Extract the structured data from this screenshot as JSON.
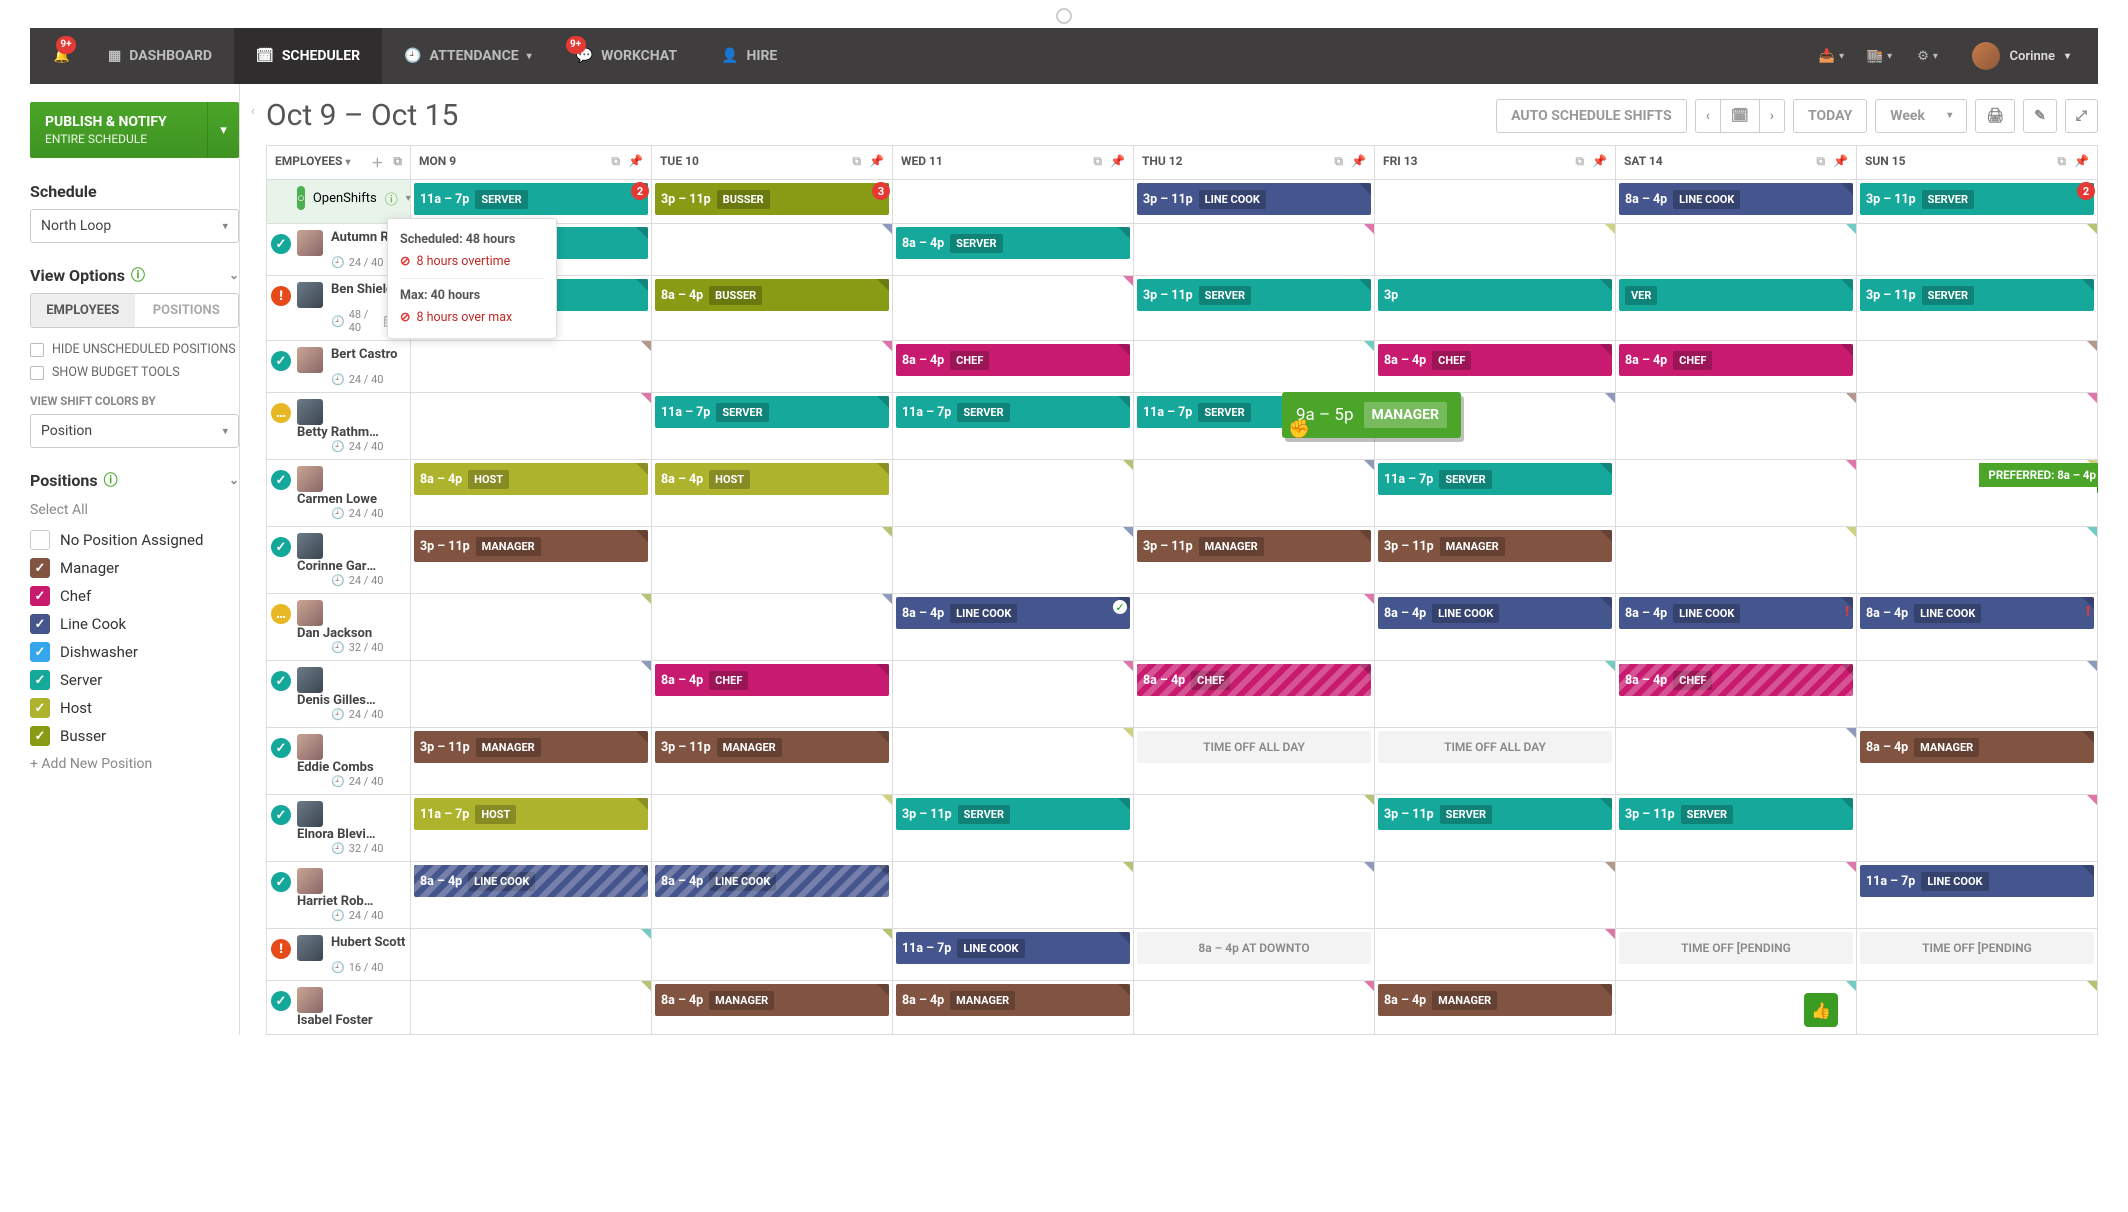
{
  "nav": {
    "alerts_badge": "9+",
    "dashboard": "DASHBOARD",
    "scheduler": "SCHEDULER",
    "attendance": "ATTENDANCE",
    "workchat": "WORKCHAT",
    "workchat_badge": "9+",
    "hire": "HIRE",
    "user": "Corinne"
  },
  "sidebar": {
    "publish_title": "PUBLISH & NOTIFY",
    "publish_sub": "ENTIRE SCHEDULE",
    "schedule_h": "Schedule",
    "schedule_value": "North Loop",
    "viewopts_h": "View Options",
    "toggle_emp": "EMPLOYEES",
    "toggle_pos": "POSITIONS",
    "chk_hide": "HIDE UNSCHEDULED POSITIONS",
    "chk_budget": "SHOW BUDGET TOOLS",
    "colors_label": "VIEW SHIFT COLORS BY",
    "colors_value": "Position",
    "positions_h": "Positions",
    "select_all": "Select All",
    "add_pos": "+ Add New Position",
    "positions": [
      {
        "label": "No Position Assigned",
        "color": "#fff",
        "empty": true
      },
      {
        "label": "Manager",
        "color": "#805441"
      },
      {
        "label": "Chef",
        "color": "#c81b70"
      },
      {
        "label": "Line Cook",
        "color": "#45558e"
      },
      {
        "label": "Dishwasher",
        "color": "#36a6ec"
      },
      {
        "label": "Server",
        "color": "#15a89b"
      },
      {
        "label": "Host",
        "color": "#aeb32e"
      },
      {
        "label": "Busser",
        "color": "#879b14"
      }
    ]
  },
  "toolbar": {
    "date_range": "Oct 9 – Oct 15",
    "auto": "AUTO SCHEDULE SHIFTS",
    "today": "TODAY",
    "view": "Week"
  },
  "days": [
    "EMPLOYEES",
    "MON 9",
    "TUE 10",
    "WED 11",
    "THU 12",
    "FRI 13",
    "SAT 14",
    "SUN 15"
  ],
  "open": {
    "label": "OpenShifts"
  },
  "openshifts": [
    {
      "day": 1,
      "time": "11a – 7p",
      "role": "SERVER",
      "cls": "c-server",
      "badge": "2"
    },
    {
      "day": 2,
      "time": "3p – 11p",
      "role": "BUSSER",
      "cls": "c-busser",
      "badge": "3"
    },
    {
      "day": 4,
      "time": "3p – 11p",
      "role": "LINE COOK",
      "cls": "c-linecook"
    },
    {
      "day": 6,
      "time": "8a – 4p",
      "role": "LINE COOK",
      "cls": "c-linecook"
    },
    {
      "day": 7,
      "time": "3p – 11p",
      "role": "SERVER",
      "cls": "c-server",
      "badge": "2"
    }
  ],
  "tooltip": {
    "sched_l": "Scheduled:",
    "sched_v": "48 hours",
    "ot": "8 hours overtime",
    "max_l": "Max:",
    "max_v": "40 hours",
    "over": "8 hours over max"
  },
  "drag": {
    "time": "9a – 5p",
    "role": "MANAGER"
  },
  "preferred": "PREFERRED: 8a – 4p",
  "employees": [
    {
      "name": "Autumn Ro…",
      "status": "ok",
      "sub": "24 / 40",
      "shifts": [
        {
          "day": 1,
          "time": "",
          "role": "VER",
          "cls": "c-server"
        },
        {
          "day": 3,
          "time": "8a – 4p",
          "role": "SERVER",
          "cls": "c-server"
        }
      ]
    },
    {
      "name": "Ben Shield…",
      "status": "err",
      "sub": "48 / 40",
      "sub2": "3",
      "shifts": [
        {
          "day": 1,
          "time": "",
          "role": "VER",
          "cls": "c-server"
        },
        {
          "day": 2,
          "time": "8a – 4p",
          "role": "BUSSER",
          "cls": "c-busser"
        },
        {
          "day": 4,
          "time": "3p – 11p",
          "role": "SERVER",
          "cls": "c-server"
        },
        {
          "day": 5,
          "time": "3p",
          "role": "",
          "cls": "c-server",
          "cut": true
        },
        {
          "day": 6,
          "time": "",
          "role": "VER",
          "cls": "c-server",
          "cut": true
        },
        {
          "day": 7,
          "time": "3p – 11p",
          "role": "SERVER",
          "cls": "c-server"
        }
      ]
    },
    {
      "name": "Bert Castro",
      "status": "ok",
      "sub": "24 / 40",
      "shifts": [
        {
          "day": 3,
          "time": "8a – 4p",
          "role": "CHEF",
          "cls": "c-chef"
        },
        {
          "day": 5,
          "time": "8a – 4p",
          "role": "CHEF",
          "cls": "c-chef"
        },
        {
          "day": 6,
          "time": "8a – 4p",
          "role": "CHEF",
          "cls": "c-chef"
        }
      ]
    },
    {
      "name": "Betty Rathmen",
      "status": "warn",
      "sub": "24 / 40",
      "shifts": [
        {
          "day": 2,
          "time": "11a – 7p",
          "role": "SERVER",
          "cls": "c-server"
        },
        {
          "day": 3,
          "time": "11a – 7p",
          "role": "SERVER",
          "cls": "c-server"
        },
        {
          "day": 4,
          "time": "11a – 7p",
          "role": "SERVER",
          "cls": "c-server"
        }
      ]
    },
    {
      "name": "Carmen Lowe",
      "status": "ok",
      "sub": "24 / 40",
      "shifts": [
        {
          "day": 1,
          "time": "8a – 4p",
          "role": "HOST",
          "cls": "c-host"
        },
        {
          "day": 2,
          "time": "8a – 4p",
          "role": "HOST",
          "cls": "c-host"
        },
        {
          "day": 5,
          "time": "11a – 7p",
          "role": "SERVER",
          "cls": "c-server"
        }
      ],
      "pref_day": 7
    },
    {
      "name": "Corinne Garris…",
      "status": "ok",
      "sub": "24 / 40",
      "shifts": [
        {
          "day": 1,
          "time": "3p – 11p",
          "role": "MANAGER",
          "cls": "c-manager"
        },
        {
          "day": 4,
          "time": "3p – 11p",
          "role": "MANAGER",
          "cls": "c-manager"
        },
        {
          "day": 5,
          "time": "3p – 11p",
          "role": "MANAGER",
          "cls": "c-manager"
        }
      ]
    },
    {
      "name": "Dan Jackson",
      "status": "warn",
      "sub": "32 / 40",
      "shifts": [
        {
          "day": 3,
          "time": "8a – 4p",
          "role": "LINE COOK",
          "cls": "c-linecook",
          "check": true
        },
        {
          "day": 5,
          "time": "8a – 4p",
          "role": "LINE COOK",
          "cls": "c-linecook"
        },
        {
          "day": 6,
          "time": "8a – 4p",
          "role": "LINE COOK",
          "cls": "c-linecook",
          "red": true
        },
        {
          "day": 7,
          "time": "8a – 4p",
          "role": "LINE COOK",
          "cls": "c-linecook",
          "red": true
        }
      ]
    },
    {
      "name": "Denis Gillespie",
      "status": "ok",
      "sub": "24 / 40",
      "shifts": [
        {
          "day": 2,
          "time": "8a – 4p",
          "role": "CHEF",
          "cls": "c-chef"
        },
        {
          "day": 4,
          "time": "8a – 4p",
          "role": "CHEF",
          "cls": "c-chef",
          "hatch": true
        },
        {
          "day": 6,
          "time": "8a – 4p",
          "role": "CHEF",
          "cls": "c-chef",
          "hatch": true
        }
      ]
    },
    {
      "name": "Eddie Combs",
      "status": "ok",
      "sub": "24 / 40",
      "shifts": [
        {
          "day": 1,
          "time": "3p – 11p",
          "role": "MANAGER",
          "cls": "c-manager"
        },
        {
          "day": 2,
          "time": "3p – 11p",
          "role": "MANAGER",
          "cls": "c-manager"
        },
        {
          "day": 4,
          "timeoff": "TIME OFF ALL DAY"
        },
        {
          "day": 5,
          "timeoff": "TIME OFF ALL DAY"
        },
        {
          "day": 7,
          "time": "8a – 4p",
          "role": "MANAGER",
          "cls": "c-manager"
        }
      ]
    },
    {
      "name": "Elnora Blevins",
      "status": "ok",
      "sub": "32 / 40",
      "shifts": [
        {
          "day": 1,
          "time": "11a – 7p",
          "role": "HOST",
          "cls": "c-host"
        },
        {
          "day": 3,
          "time": "3p – 11p",
          "role": "SERVER",
          "cls": "c-server"
        },
        {
          "day": 5,
          "time": "3p – 11p",
          "role": "SERVER",
          "cls": "c-server"
        },
        {
          "day": 6,
          "time": "3p – 11p",
          "role": "SERVER",
          "cls": "c-server"
        }
      ]
    },
    {
      "name": "Harriet Roberts",
      "status": "ok",
      "sub": "24 / 40",
      "shifts": [
        {
          "day": 1,
          "time": "8a – 4p",
          "role": "LINE COOK",
          "cls": "c-linecook",
          "hatch": true
        },
        {
          "day": 2,
          "time": "8a – 4p",
          "role": "LINE COOK",
          "cls": "c-linecook",
          "hatch": true
        },
        {
          "day": 7,
          "time": "11a – 7p",
          "role": "LINE COOK",
          "cls": "c-linecook"
        }
      ]
    },
    {
      "name": "Hubert Scott",
      "status": "err",
      "sub": "16 / 40",
      "shifts": [
        {
          "day": 3,
          "time": "11a – 7p",
          "role": "LINE COOK",
          "cls": "c-linecook"
        },
        {
          "day": 4,
          "timeoff": "8a – 4p  AT DOWNTO"
        },
        {
          "day": 6,
          "timeoff": "TIME OFF [PENDING"
        },
        {
          "day": 7,
          "timeoff": "TIME OFF [PENDING"
        }
      ]
    },
    {
      "name": "Isabel Foster",
      "status": "ok",
      "sub": "",
      "shifts": [
        {
          "day": 2,
          "time": "8a – 4p",
          "role": "MANAGER",
          "cls": "c-manager"
        },
        {
          "day": 3,
          "time": "8a – 4p",
          "role": "MANAGER",
          "cls": "c-manager"
        },
        {
          "day": 5,
          "time": "8a – 4p",
          "role": "MANAGER",
          "cls": "c-manager"
        }
      ]
    }
  ]
}
